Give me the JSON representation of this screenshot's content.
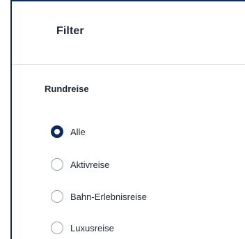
{
  "filter": {
    "title": "Filter",
    "colors": {
      "accent": "#0d2b57",
      "text": "#1c2733",
      "radio_border": "#9ba3ad",
      "divider": "#e1e4e8"
    },
    "sections": [
      {
        "title": "Rundreise",
        "selected": "Alle",
        "options": [
          {
            "label": "Alle",
            "checked": true
          },
          {
            "label": "Aktivreise",
            "checked": false
          },
          {
            "label": "Bahn-Erlebnisreise",
            "checked": false
          },
          {
            "label": "Luxusreise",
            "checked": false
          }
        ]
      }
    ]
  }
}
